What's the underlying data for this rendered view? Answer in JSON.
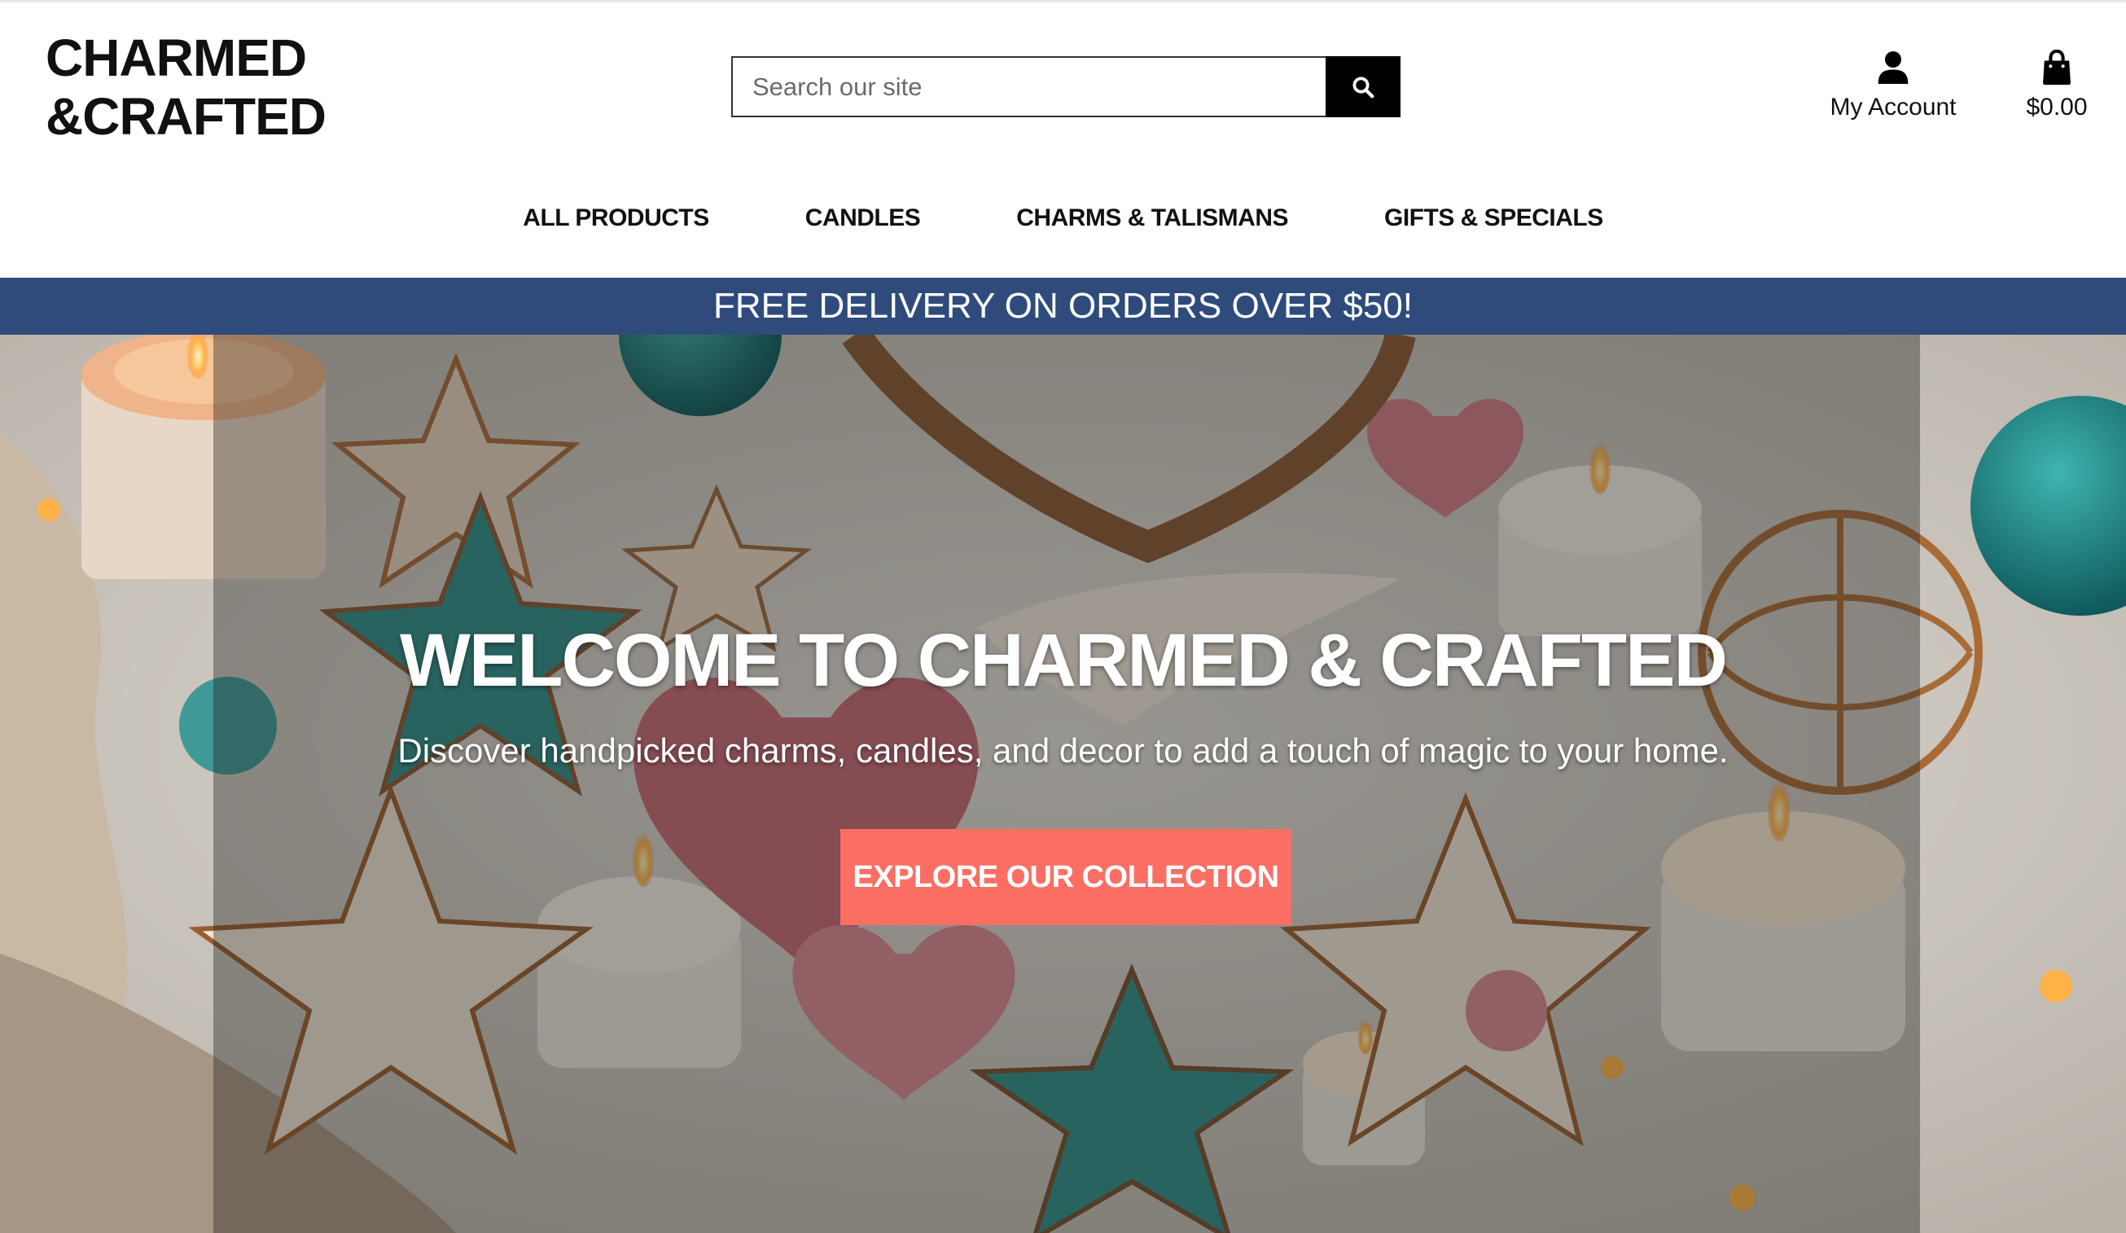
{
  "brand": {
    "line1": "CHARMED",
    "line2": "&CRAFTED"
  },
  "search": {
    "placeholder": "Search our site",
    "value": "",
    "icon": "search-icon"
  },
  "account": {
    "label": "My Account",
    "icon": "user-icon"
  },
  "cart": {
    "label": "$0.00",
    "icon": "shopping-bag-icon"
  },
  "nav": {
    "items": [
      {
        "label": "ALL PRODUCTS"
      },
      {
        "label": "CANDLES"
      },
      {
        "label": "CHARMS & TALISMANS"
      },
      {
        "label": "GIFTS & SPECIALS"
      }
    ]
  },
  "banner": {
    "text": "FREE DELIVERY ON ORDERS OVER $50!",
    "color": "#2f4b7c"
  },
  "hero": {
    "title": "WELCOME TO CHARMED & CRAFTED",
    "subtitle": "Discover handpicked charms, candles, and decor to add a touch of magic to your home.",
    "cta_label": "EXPLORE OUR COLLECTION",
    "cta_color": "#fa6e64"
  }
}
